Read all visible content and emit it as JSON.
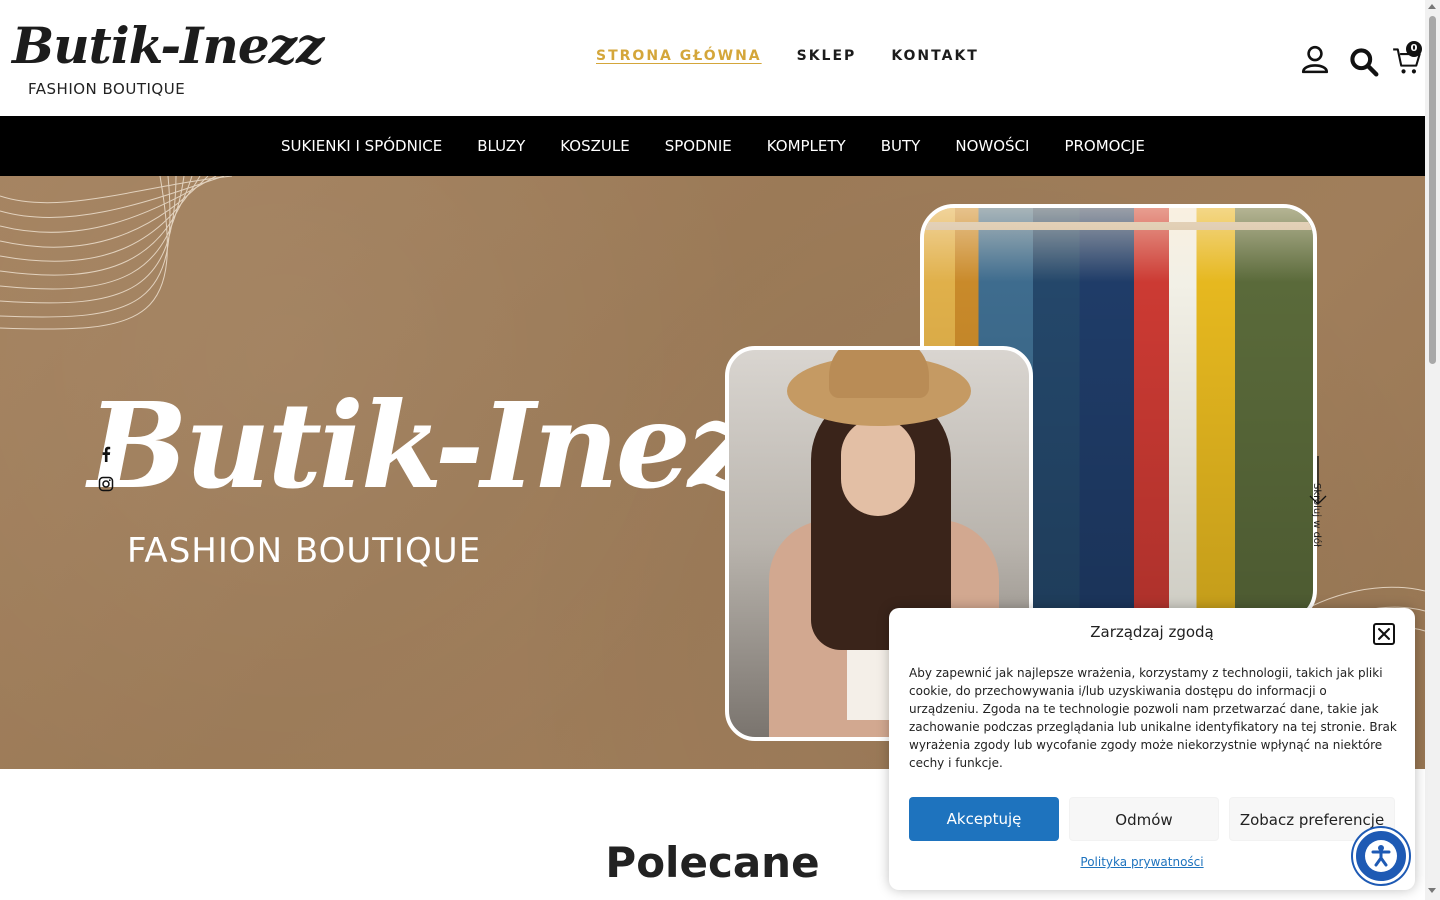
{
  "brand": {
    "script": "Butik-Inezz",
    "subtitle": "FASHION BOUTIQUE"
  },
  "main_nav": [
    {
      "label": "STRONA GŁÓWNA",
      "active": true
    },
    {
      "label": "SKLEP",
      "active": false
    },
    {
      "label": "KONTAKT",
      "active": false
    }
  ],
  "header_icons": {
    "account": "user-icon",
    "search": "search-icon",
    "cart": "cart-icon",
    "cart_count": "0"
  },
  "categories": [
    "SUKIENKI I SPÓDNICE",
    "BLUZY",
    "KOSZULE",
    "SPODNIE",
    "KOMPLETY",
    "BUTY",
    "NOWOŚCI",
    "PROMOCJE"
  ],
  "hero": {
    "script": "Butik-Inezz",
    "subtitle": "FASHION BOUTIQUE",
    "scroll_hint": "Skroluj w dół",
    "social": [
      "facebook-icon",
      "instagram-icon"
    ]
  },
  "section": {
    "title": "Polecane"
  },
  "consent": {
    "title": "Zarządzaj zgodą",
    "text": "Aby zapewnić jak najlepsze wrażenia, korzystamy z technologii, takich jak pliki cookie, do przechowywania i/lub uzyskiwania dostępu do informacji o urządzeniu. Zgoda na te technologie pozwoli nam przetwarzać dane, takie jak zachowanie podczas przeglądania lub unikalne identyfikatory na tej stronie. Brak wyrażenia zgody lub wycofanie zgody może niekorzystnie wpłynąć na niektóre cechy i funkcje.",
    "accept": "Akceptuję",
    "deny": "Odmów",
    "preferences": "Zobacz preferencje",
    "privacy_link": "Polityka prywatności"
  },
  "colors": {
    "accent": "#d4a63a",
    "primary_button": "#1e73be",
    "nav_bar": "#000000",
    "hero_bg": "#a07e5b"
  }
}
